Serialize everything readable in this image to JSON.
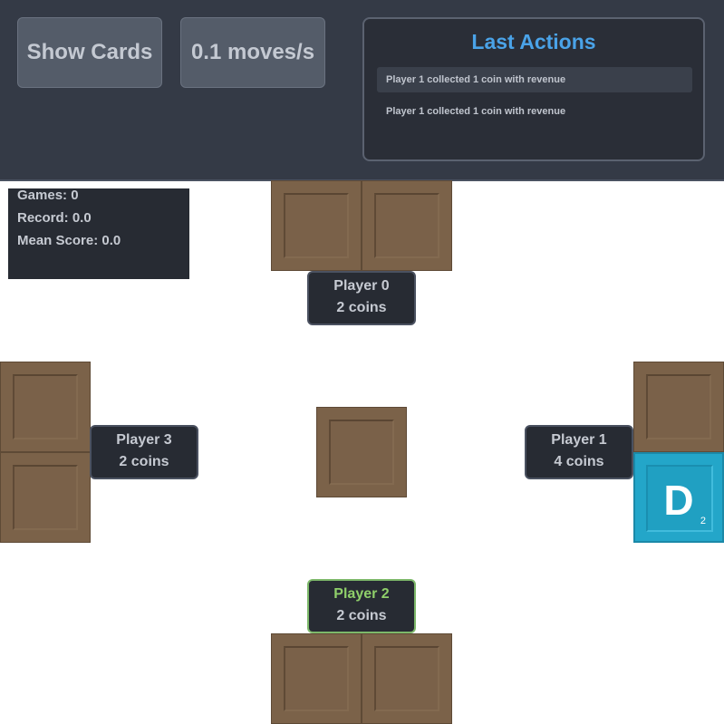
{
  "toolbar": {
    "show_cards_label": "Show Cards",
    "speed_label": "0.1 moves/s"
  },
  "last_actions": {
    "title": "Last Actions",
    "items": [
      "Player 1 collected 1 coin with revenue",
      "Player 1 collected 1 coin with revenue"
    ]
  },
  "stats": {
    "games": "Games: 0",
    "record": "Record: 0.0",
    "mean_score": "Mean Score: 0.0"
  },
  "players": [
    {
      "name": "Player 0",
      "coins": "2 coins"
    },
    {
      "name": "Player 1",
      "coins": "4 coins"
    },
    {
      "name": "Player 2",
      "coins": "2 coins"
    },
    {
      "name": "Player 3",
      "coins": "2 coins"
    }
  ],
  "revealed_card": {
    "letter": "D",
    "count": "2"
  },
  "colors": {
    "panel_bg": "#343a46",
    "title_blue": "#4aa3e8",
    "card_brown": "#7b6249",
    "duke_blue": "#23a6c9",
    "active_player_green": "#8fcf6a"
  },
  "icons": {
    "face_down_card": "card-back-icon",
    "duke_card": "duke-card-icon"
  }
}
